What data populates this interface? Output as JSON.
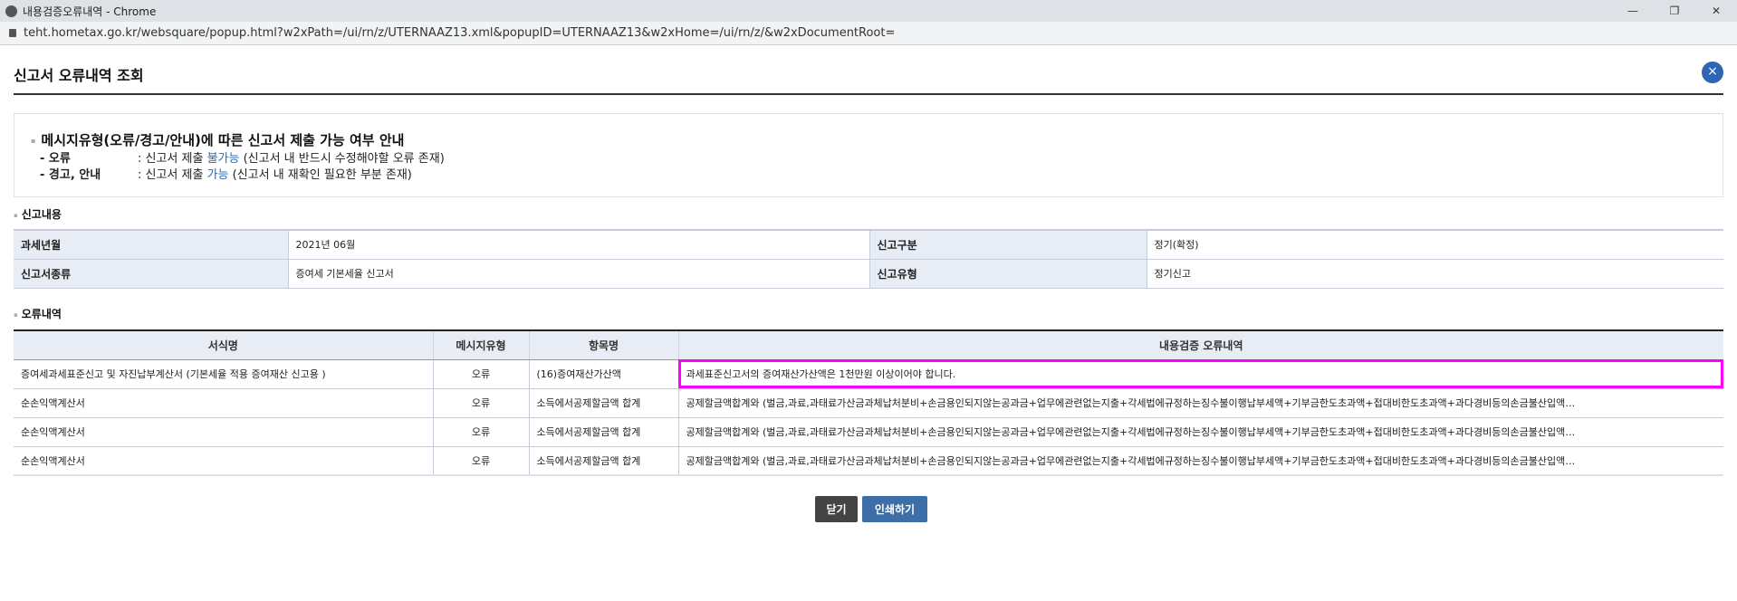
{
  "browser": {
    "window_title": "내용검증오류내역 - Chrome",
    "url": "teht.hometax.go.kr/websquare/popup.html?w2xPath=/ui/rn/z/UTERNAAZ13.xml&popupID=UTERNAAZ13&w2xHome=/ui/rn/z/&w2xDocumentRoot=",
    "controls": [
      "—",
      "❐",
      "✕"
    ]
  },
  "page": {
    "title": "신고서 오류내역 조회",
    "close_icon": "×"
  },
  "notice": {
    "heading": "메시지유형(오류/경고/안내)에 따른 신고서 제출 가능 여부 안내",
    "lines": [
      {
        "key": "- 오류",
        "pre": ": 신고서 제출 ",
        "highlight": "불가능",
        "post": " (신고서 내 반드시 수정해야할 오류 존재)"
      },
      {
        "key": "- 경고, 안내",
        "pre": ": 신고서 제출 ",
        "highlight": "가능",
        "post": " (신고서 내 재확인 필요한 부분 존재)"
      }
    ]
  },
  "report": {
    "section_label": "신고내용",
    "rows": [
      [
        {
          "label": "과세년월",
          "value": "2021년 06월"
        },
        {
          "label": "신고구분",
          "value": "정기(확정)"
        }
      ],
      [
        {
          "label": "신고서종류",
          "value": "증여세 기본세율 신고서"
        },
        {
          "label": "신고유형",
          "value": "정기신고"
        }
      ]
    ]
  },
  "errors": {
    "section_label": "오류내역",
    "columns": [
      "서식명",
      "메시지유형",
      "항목명",
      "내용검증 오류내역"
    ],
    "rows": [
      [
        "증여세과세표준신고 및 자진납부계산서 (기본세율 적용 증여재산 신고용 )",
        "오류",
        "(16)증여재산가산액",
        "과세표준신고서의 증여재산가산액은 1천만원 이상이어야 합니다."
      ],
      [
        "순손익액계산서",
        "오류",
        "소득에서공제할금액 합계",
        "공제할금액합계와 (벌금,과료,과태료가산금과체납처분비+손금용인되지않는공과금+업무에관련없는지출+각세법에규정하는징수불이행납부세액+기부금한도초과액+접대비한도초과액+과다경비등의손금불산입액…"
      ],
      [
        "순손익액계산서",
        "오류",
        "소득에서공제할금액 합계",
        "공제할금액합계와 (벌금,과료,과태료가산금과체납처분비+손금용인되지않는공과금+업무에관련없는지출+각세법에규정하는징수불이행납부세액+기부금한도초과액+접대비한도초과액+과다경비등의손금불산입액…"
      ],
      [
        "순손익액계산서",
        "오류",
        "소득에서공제할금액 합계",
        "공제할금액합계와 (벌금,과료,과태료가산금과체납처분비+손금용인되지않는공과금+업무에관련없는지출+각세법에규정하는징수불이행납부세액+기부금한도초과액+접대비한도초과액+과다경비등의손금불산입액…"
      ]
    ]
  },
  "buttons": {
    "close": "닫기",
    "print": "인쇄하기"
  },
  "colors": {
    "highlight_outline": "#ff00ff",
    "accent_blue": "#1a6ec6"
  }
}
